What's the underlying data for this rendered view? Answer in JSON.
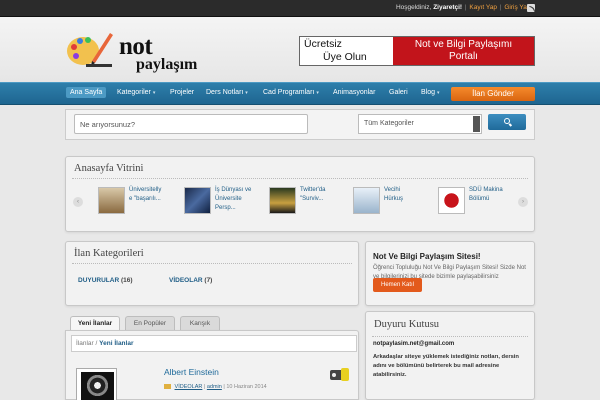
{
  "topbar": {
    "greeting": "Hoşgeldiniz,",
    "user": "Ziyaretçi!",
    "register": "Kayıt Yap",
    "login": "Giriş Yap",
    "separator": "|"
  },
  "logo": {
    "line1": "not",
    "line2": "paylaşım",
    "icon": "pencil-palette-icon"
  },
  "banner": {
    "left_line1": "Ücretsiz",
    "left_line2": "Üye Olun",
    "right_line1": "Not ve Bilgi Paylaşımı",
    "right_line2": "Portalı"
  },
  "nav": {
    "items": [
      {
        "label": "Ana Sayfa",
        "has_dropdown": false
      },
      {
        "label": "Kategoriler",
        "has_dropdown": true
      },
      {
        "label": "Projeler",
        "has_dropdown": false
      },
      {
        "label": "Ders Notları",
        "has_dropdown": true
      },
      {
        "label": "Cad Programları",
        "has_dropdown": true
      },
      {
        "label": "Animasyonlar",
        "has_dropdown": false
      },
      {
        "label": "Galeri",
        "has_dropdown": false
      },
      {
        "label": "Blog",
        "has_dropdown": true
      }
    ],
    "caret": "▾",
    "cta": "İlan Gönder",
    "accent": "#1e6590",
    "cta_color": "#e5761d"
  },
  "search": {
    "placeholder": "Ne arıyorsunuz?",
    "category": "Tüm Kategoriler",
    "button_icon": "search-icon"
  },
  "vitrin": {
    "title": "Anasayfa Vitrini",
    "prev": "‹",
    "next": "›",
    "items": [
      {
        "line1": "Üniversitelly",
        "line2": "e \"başarılı..."
      },
      {
        "line1": "İş Dünyası ve",
        "line2": "Üniversite",
        "line3": "Persp..."
      },
      {
        "line1": "Twitter'da",
        "line2": "\"Surviv..."
      },
      {
        "line1": "Vecihi",
        "line2": "Hürkuş"
      },
      {
        "line1": "SDÜ Makina",
        "line2": "Bölümü"
      }
    ]
  },
  "ilan_kategorileri": {
    "title": "İlan Kategorileri",
    "categories": [
      {
        "name": "DUYURULAR",
        "count": "(16)"
      },
      {
        "name": "VİDEOLAR",
        "count": "(7)"
      }
    ]
  },
  "site_box": {
    "title": "Not Ve Bilgi Paylaşım Sitesi!",
    "desc": "Öğrenci Topluluğu Not Ve Bilgi Paylaşım Sitesi! Sizde Not ve bilgilerinizi bu sitede bizimle paylaşabilirsiniz",
    "button": "Hemen Katıl"
  },
  "tabs": [
    "Yeni İlanlar",
    "En Popüler",
    "Karışık"
  ],
  "breadcrumb": {
    "root": "İlanlar",
    "sep": "/",
    "current": "Yeni İlanlar"
  },
  "listing": {
    "title": "Albert Einstein",
    "category": "VİDEOLAR",
    "author": "admin",
    "date": "10 Haziran 2014",
    "sep": "|"
  },
  "duyuru": {
    "title": "Duyuru Kutusu",
    "email": "notpaylasim.net@gmail.com",
    "text": "Arkadaşlar siteye yüklemek istediğiniz notları, dersin adını ve bölümünü belirterek bu mail adresine atabilirsiniz."
  }
}
